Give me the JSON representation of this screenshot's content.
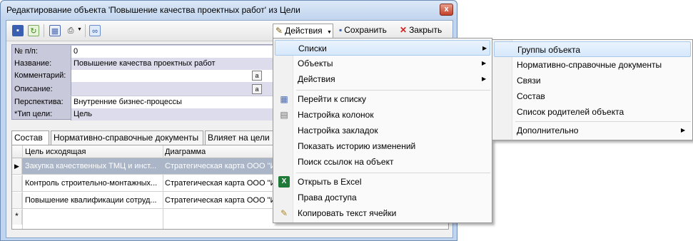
{
  "window": {
    "title": "Редактирование объекта 'Повышение качества проектных работ' из Цели",
    "close_glyph": "x"
  },
  "toolbar": {
    "actions_label": "Действия",
    "save_label": "Сохранить",
    "close_label": "Закрыть"
  },
  "form": {
    "fields": [
      {
        "label": "№ п/п:",
        "value": "0"
      },
      {
        "label": "Название:",
        "value": "Повышение качества проектных работ"
      },
      {
        "label": "Комментарий:",
        "value": ""
      },
      {
        "label": "Описание:",
        "value": ""
      },
      {
        "label": "Перспектива:",
        "value": "Внутренние бизнес-процессы"
      },
      {
        "label": "*Тип цели:",
        "value": "Цель"
      }
    ],
    "ellipsis_glyph": "a"
  },
  "tabs": [
    "Состав",
    "Нормативно-справочные документы",
    "Влияет на цели"
  ],
  "grid": {
    "columns": [
      "Цель исходящая",
      "Диаграмма"
    ],
    "rows": [
      {
        "goal": "Закупка качественных ТМЦ и инст...",
        "diagram": "Стратегическая карта ООО \"И"
      },
      {
        "goal": "Контроль строительно-монтажных...",
        "diagram": "Стратегическая карта ООО \"И"
      },
      {
        "goal": "Повышение квалификации сотруд...",
        "diagram": "Стратегическая карта ООО \"И"
      }
    ],
    "current_row_marker": "▶",
    "new_row_marker": "*"
  },
  "menu": {
    "items": [
      {
        "label": "Списки",
        "icon": "",
        "submenu": true
      },
      {
        "label": "Объекты",
        "icon": "",
        "submenu": true
      },
      {
        "label": "Действия",
        "icon": "",
        "submenu": true
      },
      {
        "label": "Перейти к списку",
        "icon": "grid-icon",
        "submenu": false
      },
      {
        "label": "Настройка колонок",
        "icon": "columns-settings-icon",
        "submenu": false
      },
      {
        "label": "Настройка закладок",
        "icon": "",
        "submenu": false
      },
      {
        "label": "Показать историю изменений",
        "icon": "",
        "submenu": false
      },
      {
        "label": "Поиск ссылок на объект",
        "icon": "",
        "submenu": false
      },
      {
        "label": "Открыть в Excel",
        "icon": "excel-icon",
        "submenu": false
      },
      {
        "label": "Права доступа",
        "icon": "",
        "submenu": false
      },
      {
        "label": "Копировать текст ячейки",
        "icon": "brush-icon",
        "submenu": false
      }
    ]
  },
  "submenu": {
    "items": [
      {
        "label": "Группы объекта",
        "submenu": false
      },
      {
        "label": "Нормативно-справочные документы",
        "submenu": false
      },
      {
        "label": "Связи",
        "submenu": false
      },
      {
        "label": "Состав",
        "submenu": false
      },
      {
        "label": "Список родителей объекта",
        "submenu": false
      },
      {
        "label": "Дополнительно",
        "submenu": true
      }
    ]
  },
  "colors": {
    "window_frame": "#c2d5ee",
    "form_bg": "#c9c9dc",
    "highlight": "#d6e8fb",
    "selected_row": "#aab6c8"
  }
}
